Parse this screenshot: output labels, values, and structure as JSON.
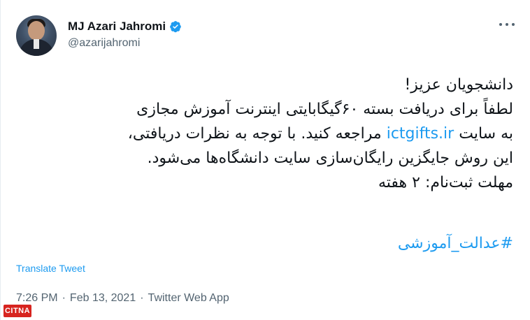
{
  "author": {
    "name": "MJ Azari Jahromi",
    "handle": "@azarijahromi"
  },
  "tweet": {
    "lines": [
      "دانشجویان عزیز!",
      "لطفاً برای دریافت بسته ۶۰گیگابایتی اینترنت آموزش مجازی",
      "به سایت",
      "ictgifts.ir",
      "مراجعه کنید. با توجه به نظرات دریافتی،",
      "این روش جایگزین رایگان‌سازی سایت دانشگاه‌ها می‌شود.",
      "مهلت ثبت‌نام: ۲ هفته"
    ],
    "hashtag": "#عدالت_آموزشی"
  },
  "translate_label": "Translate Tweet",
  "meta": {
    "time": "7:26 PM",
    "date": "Feb 13, 2021",
    "source": "Twitter Web App"
  },
  "watermark": {
    "text": "CITNA"
  },
  "colors": {
    "link": "#1d9bf0",
    "verified": "#1d9bf0",
    "secondary_text": "#536471",
    "watermark": "#d7241f"
  },
  "icons": {
    "verified": "verified-badge-icon",
    "more": "more-options-icon"
  }
}
